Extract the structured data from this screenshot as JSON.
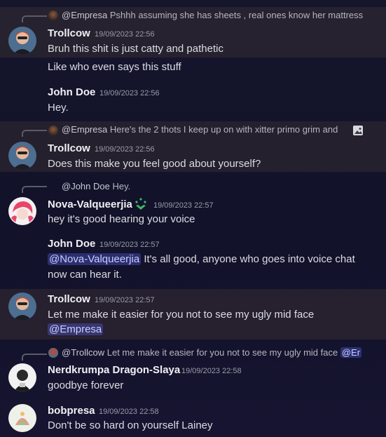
{
  "messages": [
    {
      "reply": {
        "author": "@Empresa",
        "text": "Pshhh assuming she has sheets , real ones know her mattress"
      },
      "author": "Trollcow",
      "time": "19/09/2023 22:56",
      "text": "Bruh this shit is just catty and pathetic"
    },
    {
      "text": "Like who even says this stuff"
    },
    {
      "author": "John Doe",
      "time": "19/09/2023 22:56",
      "text": "Hey."
    },
    {
      "reply": {
        "author": "@Empresa",
        "text": "Here's the 2 thots I keep up on with xitter primo grim and"
      },
      "author": "Trollcow",
      "time": "19/09/2023 22:56",
      "text": "Does this make you feel good about yourself?"
    },
    {
      "reply": {
        "author": "@John Doe",
        "text": "Hey."
      },
      "author": "Nova-Valqueerjia",
      "time": "19/09/2023 22:57",
      "text": "hey it's good hearing your voice"
    },
    {
      "author": "John Doe",
      "time": "19/09/2023 22:57",
      "mention": "@Nova-Valqueerjia",
      "text": "It's all good, anyone who goes into voice chat now can hear it."
    },
    {
      "author": "Trollcow",
      "time": "19/09/2023 22:57",
      "text": "Let me make it easier for you not to see my ugly mid face",
      "mention": "@Empresa"
    },
    {
      "reply": {
        "author": "@Trollcow",
        "text": "Let me make it easier for you not to see my ugly mid face",
        "mention": "@Er"
      },
      "author": "Nerdkrumpa Dragon-Slaya",
      "time": "19/09/2023 22:58",
      "text": "goodbye forever"
    },
    {
      "author": "bobpresa",
      "time": "19/09/2023 22:58",
      "text": "Don't be so hard on yourself Lainey"
    }
  ],
  "colors": {
    "highlight": "#2a2230",
    "mention_bg": "#3b3f8a",
    "accent": "#5865f2"
  }
}
